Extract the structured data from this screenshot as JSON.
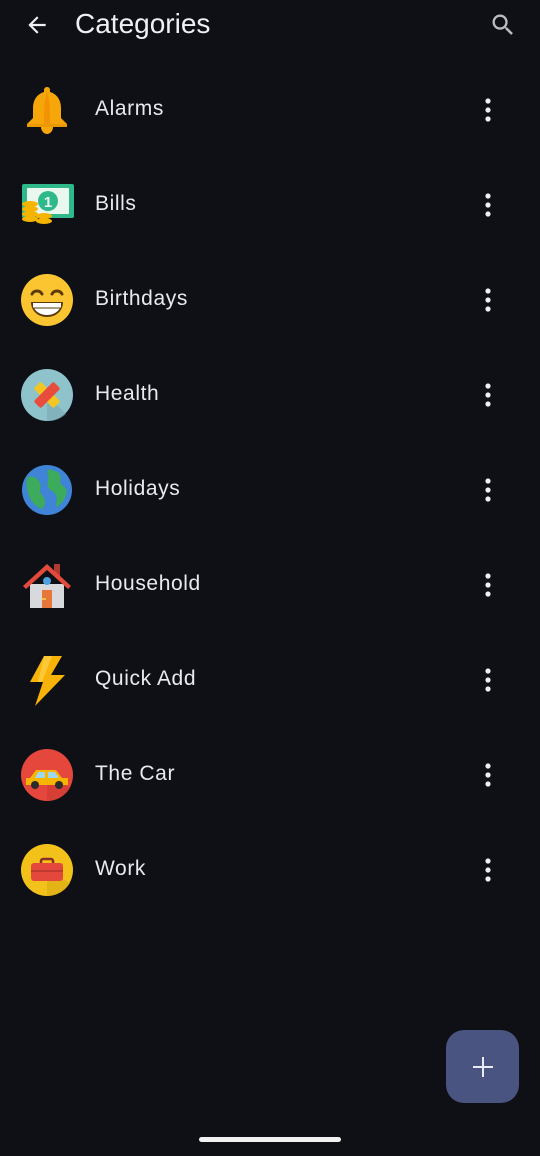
{
  "header": {
    "title": "Categories"
  },
  "categories": [
    {
      "label": "Alarms",
      "icon": "bell-icon"
    },
    {
      "label": "Bills",
      "icon": "money-icon"
    },
    {
      "label": "Birthdays",
      "icon": "grinning-face-icon"
    },
    {
      "label": "Health",
      "icon": "bandage-icon"
    },
    {
      "label": "Holidays",
      "icon": "globe-icon"
    },
    {
      "label": "Household",
      "icon": "house-icon"
    },
    {
      "label": "Quick Add",
      "icon": "lightning-icon"
    },
    {
      "label": "The Car",
      "icon": "car-icon"
    },
    {
      "label": "Work",
      "icon": "briefcase-icon"
    }
  ],
  "colors": {
    "background": "#0e1015",
    "fab": "#4a5480",
    "text": "#e8eaee"
  }
}
